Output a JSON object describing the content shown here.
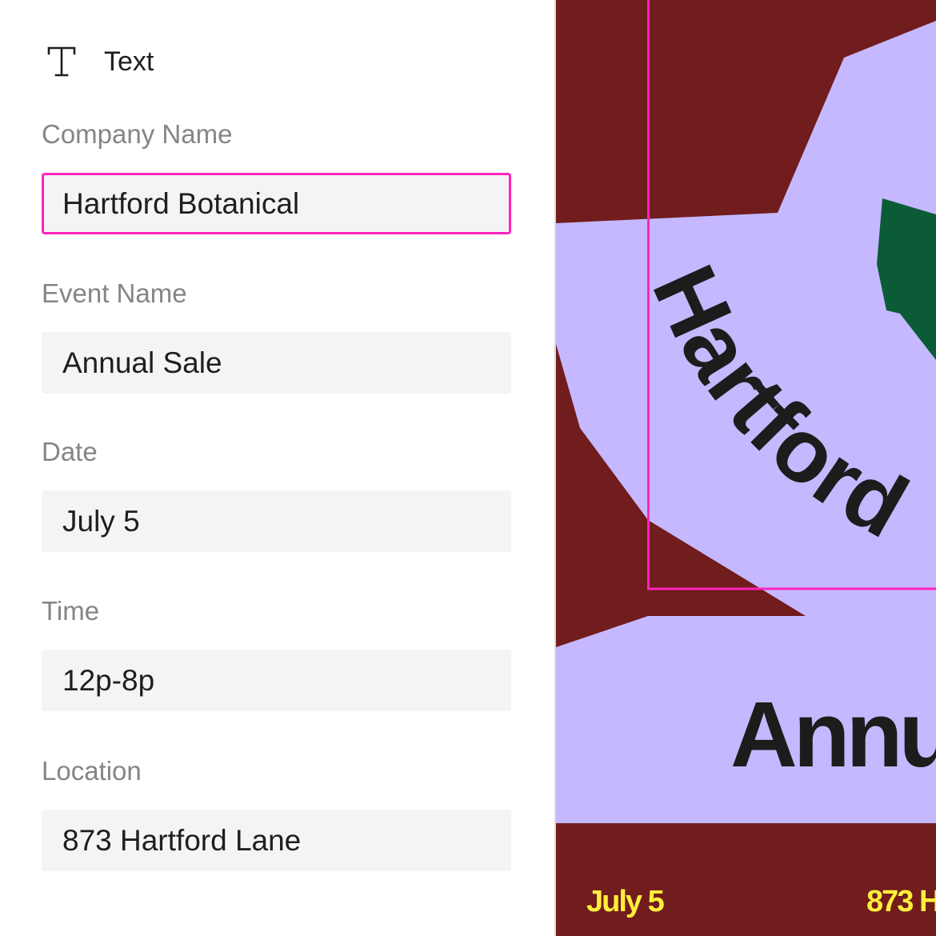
{
  "panel": {
    "section_title": "Text",
    "section_icon": "text-type-icon",
    "fields": [
      {
        "label": "Company Name",
        "value": "Hartford Botanical",
        "selected": true
      },
      {
        "label": "Event Name",
        "value": "Annual Sale",
        "selected": false
      },
      {
        "label": "Date",
        "value": "July 5",
        "selected": false
      },
      {
        "label": "Time",
        "value": "12p-8p",
        "selected": false
      },
      {
        "label": "Location",
        "value": "873 Hartford Lane",
        "selected": false
      }
    ]
  },
  "poster": {
    "company_text": "Hartford",
    "event_text": "Annu",
    "date_text": "July 5",
    "location_text": "873 H",
    "colors": {
      "background": "#711c1d",
      "lavender": "#c5b8ff",
      "green": "#0b5c36",
      "title_text": "#1c1c1c",
      "footer_text": "#ffee3c",
      "selection": "#ff24bd"
    }
  }
}
